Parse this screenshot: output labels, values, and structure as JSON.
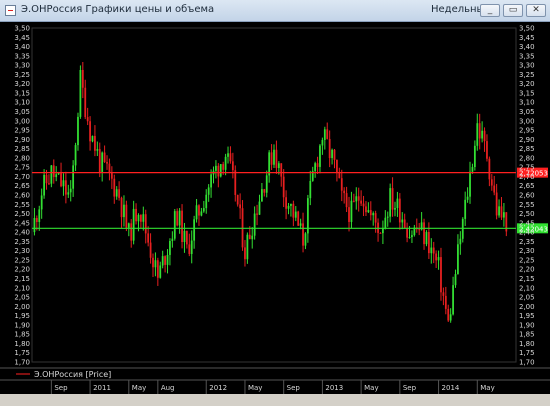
{
  "window": {
    "title": "Э.ОНРоссия Графики цены и объема",
    "period": "Недельный",
    "minimize_label": "_",
    "maximize_label": "▭",
    "close_label": "✕"
  },
  "legend": {
    "label": "Э.ОНРоссия [Price]"
  },
  "chart_data": {
    "type": "candlestick",
    "y_ticks": [
      "3,50",
      "3,45",
      "3,40",
      "3,35",
      "3,30",
      "3,25",
      "3,20",
      "3,15",
      "3,10",
      "3,05",
      "3,00",
      "2,95",
      "2,90",
      "2,85",
      "2,80",
      "2,75",
      "2,70",
      "2,65",
      "2,60",
      "2,55",
      "2,50",
      "2,45",
      "2,40",
      "2,35",
      "2,30",
      "2,25",
      "2,20",
      "2,15",
      "2,10",
      "2,05",
      "2,00",
      "1,95",
      "1,90",
      "1,85",
      "1,80",
      "1,75",
      "1,70"
    ],
    "ylim": [
      1.7,
      3.5
    ],
    "x_labels": [
      "Sep",
      "2011",
      "May",
      "Aug",
      "2012",
      "May",
      "Sep",
      "2013",
      "May",
      "Sep",
      "2014",
      "May"
    ],
    "x_range": [
      "2010-07",
      "2014-09"
    ],
    "x_label_dates": [
      "2010-09",
      "2011-01",
      "2011-05",
      "2011-08",
      "2012-01",
      "2012-05",
      "2012-09",
      "2013-01",
      "2013-05",
      "2013-09",
      "2014-01",
      "2014-05"
    ],
    "horizontal_lines": [
      {
        "value": 2.72053,
        "label": "2,72053",
        "color": "#ff2020"
      },
      {
        "value": 2.42043,
        "label": "2,42043",
        "color": "#30e030"
      }
    ],
    "close_path": [
      [
        "2010-07",
        2.4
      ],
      [
        "2010-08",
        2.62
      ],
      [
        "2010-09",
        2.72
      ],
      [
        "2010-10",
        2.66
      ],
      [
        "2010-11",
        2.58
      ],
      [
        "2010-12",
        3.22
      ],
      [
        "2011-01",
        2.95
      ],
      [
        "2011-02",
        2.78
      ],
      [
        "2011-03",
        2.7
      ],
      [
        "2011-04",
        2.6
      ],
      [
        "2011-05",
        2.38
      ],
      [
        "2011-06",
        2.55
      ],
      [
        "2011-07",
        2.36
      ],
      [
        "2011-08",
        2.15
      ],
      [
        "2011-09",
        2.32
      ],
      [
        "2011-10",
        2.5
      ],
      [
        "2011-11",
        2.3
      ],
      [
        "2011-12",
        2.48
      ],
      [
        "2012-01",
        2.62
      ],
      [
        "2012-02",
        2.74
      ],
      [
        "2012-03",
        2.82
      ],
      [
        "2012-04",
        2.62
      ],
      [
        "2012-05",
        2.3
      ],
      [
        "2012-06",
        2.5
      ],
      [
        "2012-07",
        2.68
      ],
      [
        "2012-08",
        2.86
      ],
      [
        "2012-09",
        2.62
      ],
      [
        "2012-10",
        2.5
      ],
      [
        "2012-11",
        2.36
      ],
      [
        "2012-12",
        2.7
      ],
      [
        "2013-01",
        2.92
      ],
      [
        "2013-02",
        2.8
      ],
      [
        "2013-03",
        2.58
      ],
      [
        "2013-04",
        2.5
      ],
      [
        "2013-05",
        2.62
      ],
      [
        "2013-06",
        2.48
      ],
      [
        "2013-07",
        2.42
      ],
      [
        "2013-08",
        2.58
      ],
      [
        "2013-09",
        2.52
      ],
      [
        "2013-10",
        2.4
      ],
      [
        "2013-11",
        2.42
      ],
      [
        "2013-12",
        2.34
      ],
      [
        "2014-01",
        2.2
      ],
      [
        "2014-02",
        1.9
      ],
      [
        "2014-03",
        2.28
      ],
      [
        "2014-04",
        2.62
      ],
      [
        "2014-05",
        2.98
      ],
      [
        "2014-06",
        2.82
      ],
      [
        "2014-07",
        2.52
      ],
      [
        "2014-08",
        2.46
      ]
    ]
  },
  "colors": {
    "background": "#000000",
    "up_candle": "#33e033",
    "down_candle": "#e82020",
    "axis_text": "#d8d8d8",
    "legend_line": "#ff2020"
  }
}
